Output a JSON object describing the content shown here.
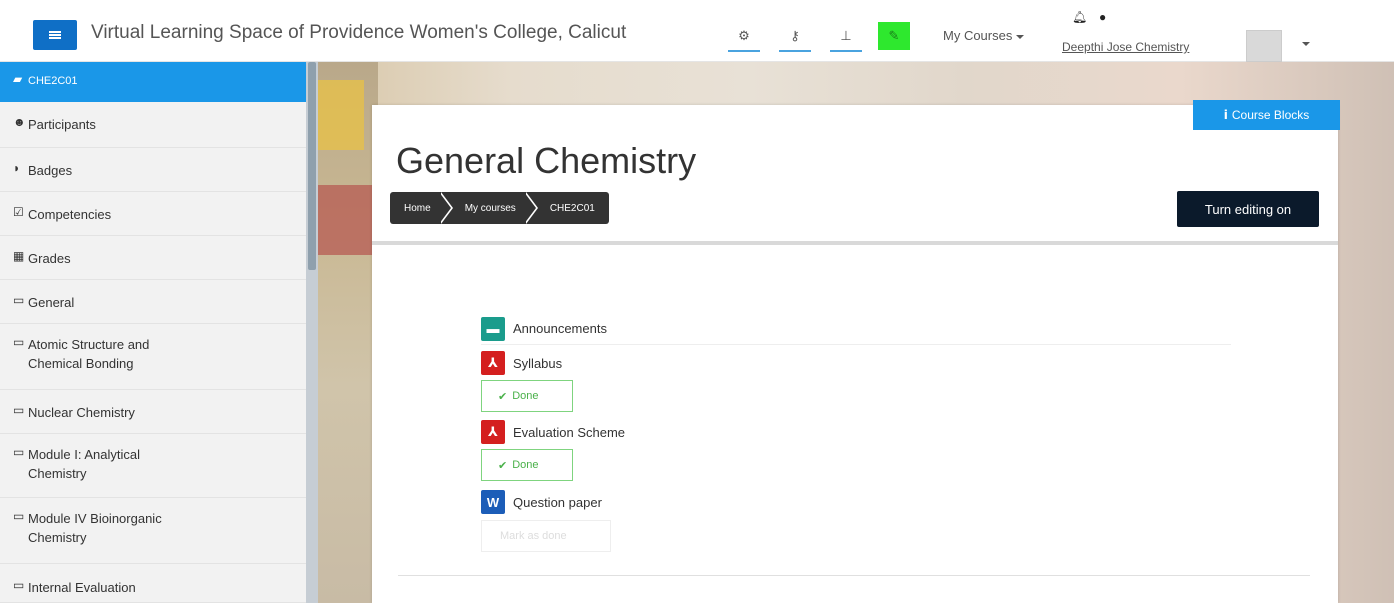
{
  "header": {
    "site_name": "Virtual Learning Space of Providence Women's College, Calicut",
    "my_courses_label": "My Courses",
    "user_name": "Deepthi Jose Chemistry",
    "icons": [
      "menu-icon",
      "cogs-icon",
      "key-icon",
      "sitemap-icon",
      "edit-icon",
      "bell-icon",
      "chat-icon"
    ]
  },
  "sidebar": {
    "items": [
      {
        "label": "CHE2C01",
        "icon": "graduation-cap-icon",
        "active": true
      },
      {
        "label": "Participants",
        "icon": "users-icon"
      },
      {
        "label": "Badges",
        "icon": "shield-icon"
      },
      {
        "label": "Competencies",
        "icon": "check-square-icon"
      },
      {
        "label": "Grades",
        "icon": "table-icon"
      },
      {
        "label": "General",
        "icon": "folder-icon"
      },
      {
        "label": "Atomic Structure and Chemical Bonding",
        "icon": "folder-icon"
      },
      {
        "label": "Nuclear Chemistry",
        "icon": "folder-icon"
      },
      {
        "label": "Module I: Analytical Chemistry",
        "icon": "folder-icon"
      },
      {
        "label": "Module IV Bioinorganic Chemistry",
        "icon": "folder-icon"
      },
      {
        "label": "Internal Evaluation",
        "icon": "folder-icon"
      }
    ]
  },
  "main": {
    "course_blocks_label": "Course Blocks",
    "title": "General Chemistry",
    "breadcrumb": [
      "Home",
      "My courses",
      "CHE2C01"
    ],
    "edit_button": "Turn editing on",
    "activities": [
      {
        "name": "Announcements",
        "type": "forum",
        "icon_glyph": ""
      },
      {
        "name": "Syllabus",
        "type": "pdf",
        "icon_glyph": "",
        "completion": "Done"
      },
      {
        "name": "Evaluation Scheme",
        "type": "pdf",
        "icon_glyph": "",
        "completion": "Done"
      },
      {
        "name": "Question paper",
        "type": "word",
        "icon_glyph": "W",
        "completion": "Mark as done"
      }
    ]
  },
  "colors": {
    "accent": "#1a97e8",
    "nav_toggle": "#0f6fc6",
    "edit_button": "#0b1a2b",
    "done_green": "#4ab14a",
    "pdf_red": "#d41f1f"
  }
}
